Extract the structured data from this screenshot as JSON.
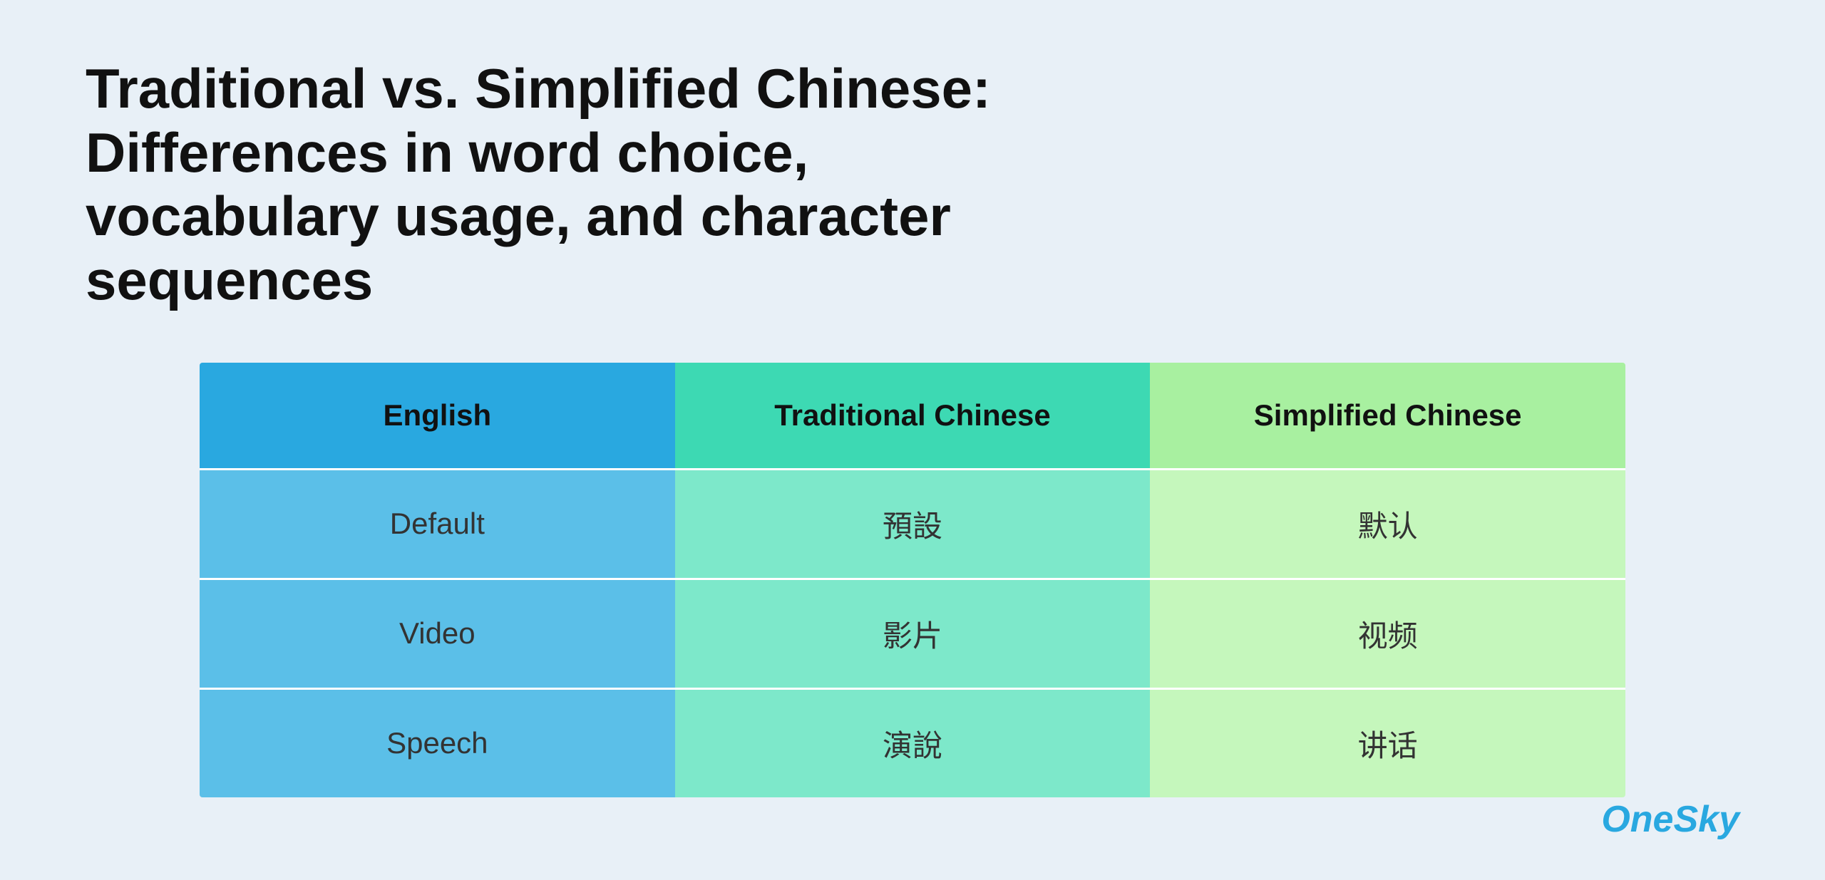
{
  "page": {
    "title": "Traditional vs. Simplified Chinese: Differences in word choice, vocabulary usage, and character sequences",
    "background_color": "#e8f0f7"
  },
  "brand": {
    "name": "OneSky"
  },
  "table": {
    "headers": {
      "english": "English",
      "traditional": "Traditional Chinese",
      "simplified": "Simplified Chinese"
    },
    "rows": [
      {
        "english": "Default",
        "traditional": "預設",
        "simplified": "默认"
      },
      {
        "english": "Video",
        "traditional": "影片",
        "simplified": "视频"
      },
      {
        "english": "Speech",
        "traditional": "演說",
        "simplified": "讲话"
      }
    ]
  }
}
